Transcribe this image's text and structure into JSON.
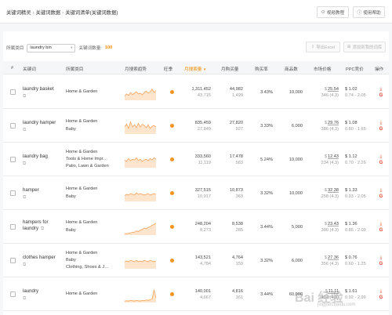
{
  "breadcrumb": [
    "关键词精灵",
    "关键词数据",
    "关键词清单(关键词数据)"
  ],
  "header": {
    "tutorial_label": "视频教程",
    "help_label": "使用帮助"
  },
  "filter": {
    "scope_label": "所属类目",
    "category_value": "laundry bin",
    "count_label": "关键词数量:",
    "count_value": "100"
  },
  "toolbar": {
    "export_label": "导出Excel",
    "add_label": "添加到我的词库"
  },
  "table": {
    "headers": {
      "index": "#",
      "keyword": "关键词",
      "category": "所属类目",
      "trend": "月搜索趋势",
      "season": "旺季",
      "monthly_search": "月搜索量",
      "monthly_purchase": "月购买量",
      "purchase_rate": "购买率",
      "products": "商品数",
      "market": "市场价格",
      "ppc": "PPC竞价",
      "ops": "操作"
    },
    "rows": [
      {
        "keyword": "laundry basket",
        "category": [
          "Home & Garden"
        ],
        "search": "1,311,452",
        "search_sub": "43,715",
        "purchase": "44,982",
        "purchase_sub": "1,499",
        "rate": "3.43%",
        "products": "10,000",
        "price": "25.54",
        "price_sub": "346 (4.3)",
        "ppc": "1.02",
        "ppc_range": "0.74 - 2.05",
        "trend": [
          0.3,
          0.45,
          0.35,
          0.55,
          0.4,
          0.5,
          0.6,
          0.45,
          0.5,
          0.4,
          0.55,
          0.65,
          0.5,
          0.6,
          0.8,
          0.55,
          0.7
        ]
      },
      {
        "keyword": "laundry hamper",
        "category": [
          "Home & Garden",
          "Baby"
        ],
        "search": "835,459",
        "search_sub": "27,849",
        "purchase": "27,820",
        "purchase_sub": "927",
        "rate": "3.33%",
        "products": "6,000",
        "price": "29.76",
        "price_sub": "386 (4.3)",
        "ppc": "1.08",
        "ppc_range": "0.80 - 1.65",
        "trend": [
          0.5,
          0.7,
          0.4,
          0.85,
          0.5,
          0.65,
          0.45,
          0.75,
          0.5,
          0.7,
          0.6,
          0.45,
          0.65,
          0.4,
          0.55,
          0.6,
          0.5
        ]
      },
      {
        "keyword": "laundry bag",
        "category": [
          "Home & Garden",
          "Tools & Home Impr…",
          "Patio, Lawn & Garden"
        ],
        "search": "333,560",
        "search_sub": "11,119",
        "purchase": "17,478",
        "purchase_sub": "583",
        "rate": "5.24%",
        "products": "10,000",
        "price": "12.43",
        "price_sub": "234 (4.3)",
        "ppc": "1.12",
        "ppc_range": "0.70 - 2.26",
        "trend": [
          0.55,
          0.45,
          0.65,
          0.5,
          0.6,
          0.55,
          0.7,
          0.5,
          0.6,
          0.45,
          0.55,
          0.6,
          0.5,
          0.65,
          0.55,
          0.7,
          0.6
        ]
      },
      {
        "keyword": "hamper",
        "category": [
          "Home & Garden",
          "Baby"
        ],
        "search": "327,515",
        "search_sub": "10,917",
        "purchase": "10,873",
        "purchase_sub": "363",
        "rate": "3.32%",
        "products": "10,000",
        "price": "32.38",
        "price_sub": "258 (4.3)",
        "ppc": "1.33",
        "ppc_range": "0.93 - 2.05",
        "trend": [
          0.4,
          0.5,
          0.45,
          0.55,
          0.5,
          0.45,
          0.6,
          0.5,
          0.55,
          0.5,
          0.45,
          0.5,
          0.55,
          0.45,
          0.5,
          0.55,
          0.5
        ]
      },
      {
        "keyword": "hampers for laundry",
        "category": [
          "Home & Garden",
          "Baby"
        ],
        "search": "248,204",
        "search_sub": "8,273",
        "purchase": "8,538",
        "purchase_sub": "285",
        "rate": "3.44%",
        "products": "5,000",
        "price": "23.43",
        "price_sub": "300 (4.3)",
        "ppc": "1.36",
        "ppc_range": "0.85 - 2.09",
        "trend": [
          0.1,
          0.1,
          0.12,
          0.15,
          0.2,
          0.2,
          0.3,
          0.25,
          0.35,
          0.4,
          0.5,
          0.45,
          0.55,
          0.6,
          0.7,
          0.75,
          0.85
        ]
      },
      {
        "keyword": "clothes hamper",
        "category": [
          "Home & Garden",
          "Baby",
          "Clothing, Shoes & J…"
        ],
        "search": "143,521",
        "search_sub": "4,784",
        "purchase": "4,764",
        "purchase_sub": "159",
        "rate": "3.32%",
        "products": "6,000",
        "price": "27.36",
        "price_sub": "356 (4.3)",
        "ppc": "0.76",
        "ppc_range": "0.60 - 1.25",
        "trend": [
          0.5,
          0.55,
          0.5,
          0.6,
          0.55,
          0.5,
          0.6,
          0.5,
          0.55,
          0.5,
          0.6,
          0.55,
          0.5,
          0.6,
          0.55,
          0.5,
          0.55
        ]
      },
      {
        "keyword": "laundry",
        "category": [
          "Home & Garden"
        ],
        "search": "140,001",
        "search_sub": "4,667",
        "purchase": "4,816",
        "purchase_sub": "161",
        "rate": "3.44%",
        "products": "60,000",
        "price": "11.11",
        "price_sub": "404 (4.8)",
        "ppc": "1.61",
        "ppc_range": "0.92 - 2.99",
        "trend": [
          0.1,
          0.12,
          0.1,
          0.15,
          0.12,
          0.1,
          0.15,
          0.12,
          0.1,
          0.15,
          0.12,
          0.18,
          0.15,
          0.2,
          0.25,
          0.9,
          0.3
        ]
      }
    ]
  },
  "watermark": {
    "main": "Bai 经验",
    "sub": "jingyan.baidu.com"
  },
  "colors": {
    "accent": "#f08a00",
    "spark_fill": "#fde4cc",
    "spark_line": "#f5a35a",
    "danger": "#e0502a"
  }
}
